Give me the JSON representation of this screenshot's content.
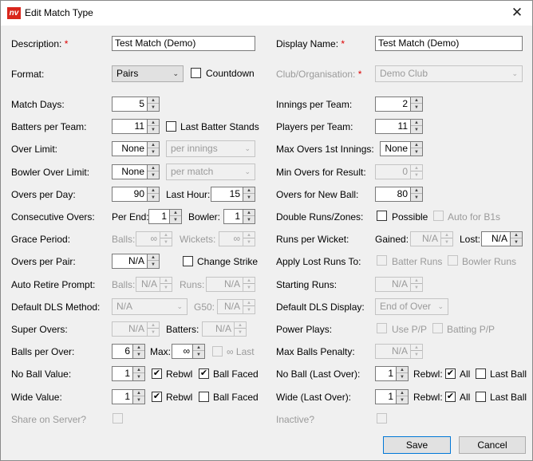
{
  "window": {
    "logo": "nv",
    "title": "Edit Match Type",
    "close_glyph": "✕"
  },
  "req_mark": "*",
  "arrow_up": "▲",
  "arrow_down": "▼",
  "chev": "⌄",
  "check": "✔",
  "left": {
    "description": {
      "label": "Description:",
      "value": "Test Match (Demo)"
    },
    "format": {
      "label": "Format:",
      "value": "Pairs",
      "countdown": "Countdown"
    },
    "match_days": {
      "label": "Match Days:",
      "value": "5"
    },
    "batters_per_team": {
      "label": "Batters per Team:",
      "value": "11",
      "last_batter_stands": "Last Batter Stands"
    },
    "over_limit": {
      "label": "Over Limit:",
      "value": "None",
      "unit": "per innings"
    },
    "bowler_over_limit": {
      "label": "Bowler Over Limit:",
      "value": "None",
      "unit": "per match"
    },
    "overs_per_day": {
      "label": "Overs per Day:",
      "value": "90",
      "last_hour_label": "Last Hour:",
      "last_hour": "15"
    },
    "consecutive_overs": {
      "label": "Consecutive Overs:",
      "per_end_label": "Per End:",
      "per_end": "1",
      "bowler_label": "Bowler:",
      "bowler": "1"
    },
    "grace_period": {
      "label": "Grace Period:",
      "balls_label": "Balls:",
      "balls": "∞",
      "wickets_label": "Wickets:",
      "wickets": "∞"
    },
    "overs_per_pair": {
      "label": "Overs per Pair:",
      "value": "N/A",
      "change_strike": "Change Strike"
    },
    "auto_retire": {
      "label": "Auto Retire Prompt:",
      "balls_label": "Balls:",
      "balls": "N/A",
      "runs_label": "Runs:",
      "runs": "N/A"
    },
    "default_dls_method": {
      "label": "Default DLS Method:",
      "value": "N/A",
      "g50_label": "G50:",
      "g50": "N/A"
    },
    "super_overs": {
      "label": "Super Overs:",
      "value": "N/A",
      "batters_label": "Batters:",
      "batters": "N/A"
    },
    "balls_per_over": {
      "label": "Balls per Over:",
      "value": "6",
      "max_label": "Max:",
      "max": "∞",
      "inf_last": "∞ Last"
    },
    "no_ball_value": {
      "label": "No Ball Value:",
      "value": "1",
      "rebwl": "Rebwl",
      "ball_faced": "Ball Faced"
    },
    "wide_value": {
      "label": "Wide Value:",
      "value": "1",
      "rebwl": "Rebwl",
      "ball_faced": "Ball Faced"
    },
    "share_on_server": {
      "label": "Share on Server?"
    }
  },
  "right": {
    "display_name": {
      "label": "Display Name:",
      "value": "Test Match (Demo)"
    },
    "club": {
      "label": "Club/Organisation:",
      "value": "Demo Club"
    },
    "innings_per_team": {
      "label": "Innings per Team:",
      "value": "2"
    },
    "players_per_team": {
      "label": "Players per Team:",
      "value": "11"
    },
    "max_overs_1st": {
      "label": "Max Overs 1st Innings:",
      "value": "None"
    },
    "min_overs_result": {
      "label": "Min Overs for Result:",
      "value": "0"
    },
    "overs_new_ball": {
      "label": "Overs for New Ball:",
      "value": "80"
    },
    "double_runs": {
      "label": "Double Runs/Zones:",
      "possible": "Possible",
      "auto_for_b1s": "Auto for B1s"
    },
    "runs_per_wicket": {
      "label": "Runs per Wicket:",
      "gained_label": "Gained:",
      "gained": "N/A",
      "lost_label": "Lost:",
      "lost": "N/A"
    },
    "apply_lost_runs": {
      "label": "Apply Lost Runs To:",
      "batter_runs": "Batter Runs",
      "bowler_runs": "Bowler Runs"
    },
    "starting_runs": {
      "label": "Starting Runs:",
      "value": "N/A"
    },
    "default_dls_display": {
      "label": "Default DLS Display:",
      "value": "End of Over"
    },
    "power_plays": {
      "label": "Power Plays:",
      "use_pp": "Use P/P",
      "batting_pp": "Batting P/P"
    },
    "max_balls_penalty": {
      "label": "Max Balls Penalty:",
      "value": "N/A"
    },
    "no_ball_last": {
      "label": "No Ball (Last Over):",
      "value": "1",
      "rebwl": "Rebwl:",
      "all": "All",
      "last_ball": "Last Ball"
    },
    "wide_last": {
      "label": "Wide (Last Over):",
      "value": "1",
      "rebwl": "Rebwl:",
      "all": "All",
      "last_ball": "Last Ball"
    },
    "inactive": {
      "label": "Inactive?"
    }
  },
  "buttons": {
    "save": "Save",
    "cancel": "Cancel"
  }
}
